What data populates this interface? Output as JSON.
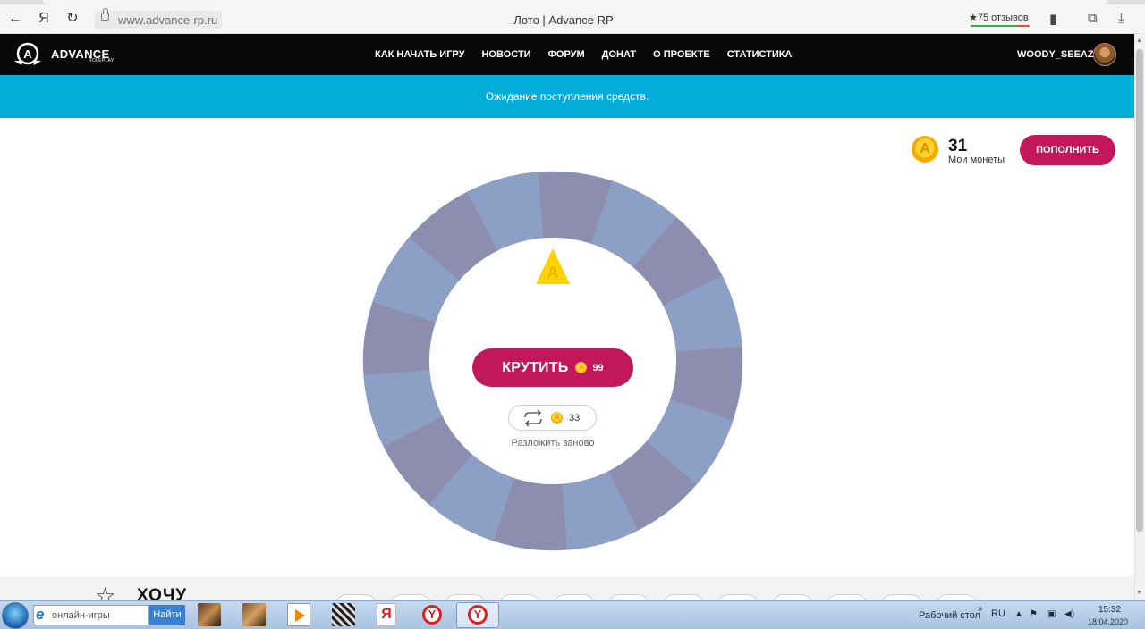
{
  "browser": {
    "url": "www.advance-rp.ru",
    "tab_title": "Лото | Advance RP",
    "reviews": "★75 отзывов",
    "back_icon": "←",
    "ya_icon": "Я",
    "reload_icon": "↻"
  },
  "header": {
    "logo_text": "ADVANCE",
    "logo_sub": "ROLEPLAY",
    "nav": [
      "КАК НАЧАТЬ ИГРУ",
      "НОВОСТИ",
      "ФОРУМ",
      "ДОНАТ",
      "О ПРОЕКТЕ",
      "СТАТИСТИКА"
    ],
    "username": "WOODY_SEEAZY"
  },
  "notice": "Ожидание поступления средств.",
  "balance": {
    "value": "31",
    "label": "Мои монеты",
    "coin_letter": "A",
    "topup_label": "ПОПОЛНИТЬ"
  },
  "wheel": {
    "segments": 16,
    "colors": [
      "#8c8daf",
      "#8ca0c6"
    ],
    "spin_label": "КРУТИТЬ",
    "spin_cost": "99",
    "reshuffle_cost": "33",
    "reshuffle_label": "Разложить заново",
    "pointer_letter": "A"
  },
  "bottom": {
    "want_text": "ХОЧУ"
  },
  "taskbar": {
    "search_text": "онлайн-игры",
    "search_button": "Найти",
    "desktop_label": "Рабочий стол",
    "language": "RU",
    "time": "15:32",
    "date": "18.04.2020"
  }
}
